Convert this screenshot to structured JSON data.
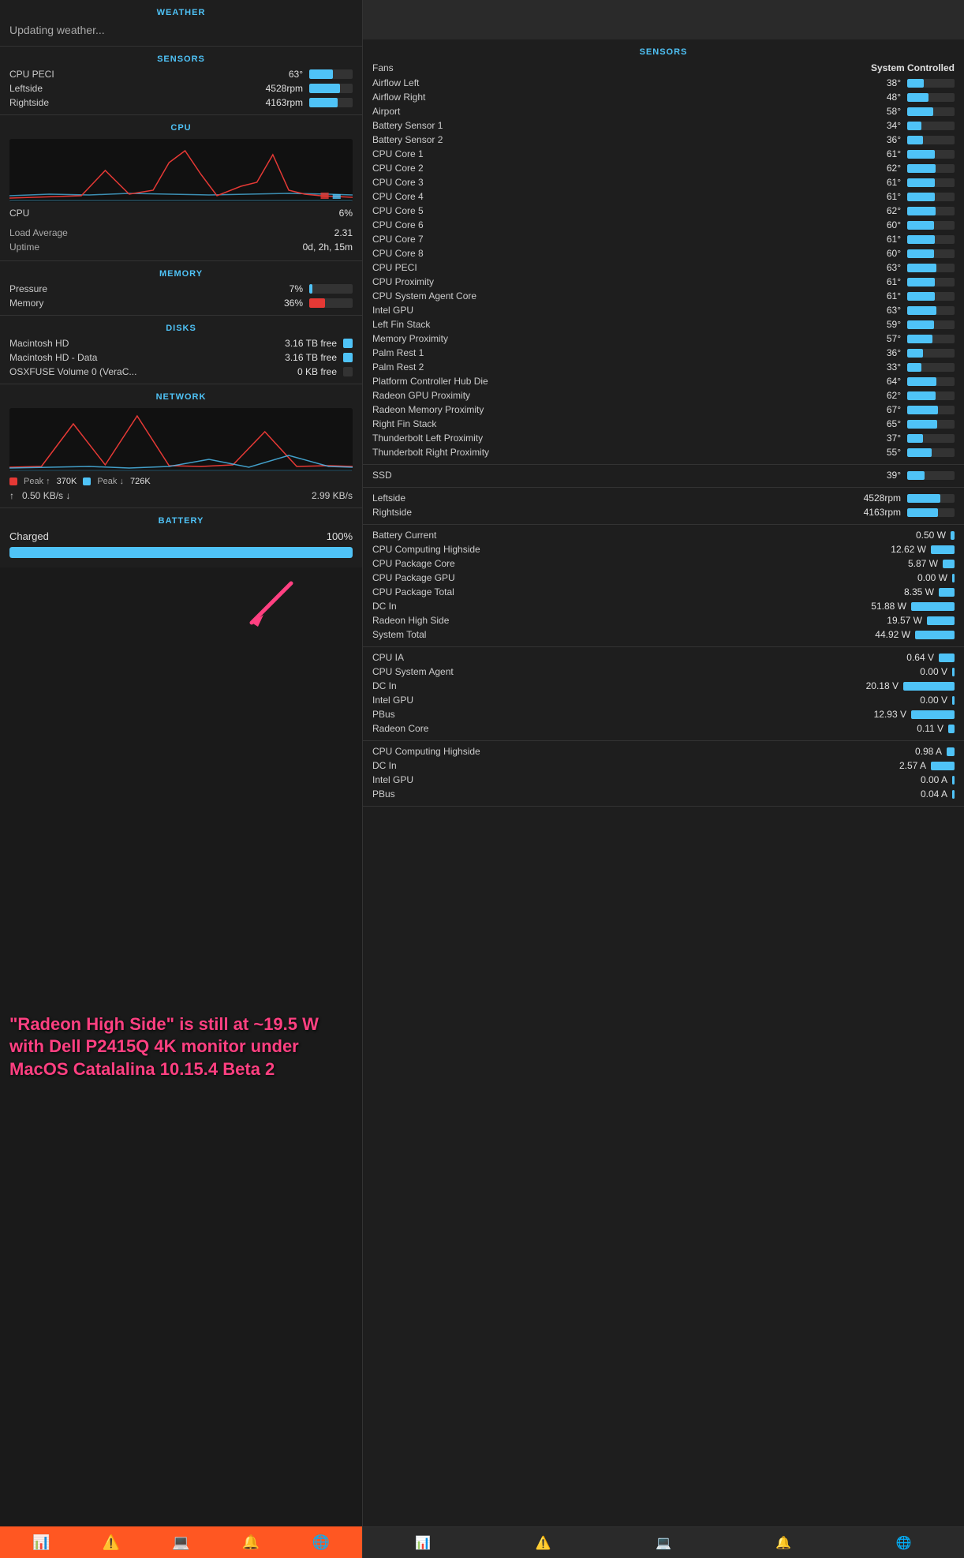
{
  "left": {
    "weather": {
      "header": "WEATHER",
      "status": "Updating weather..."
    },
    "sensors_left": {
      "header": "SENSORS",
      "items": [
        {
          "label": "CPU PECI",
          "value": "63°",
          "bar": 55
        },
        {
          "label": "Leftside",
          "value": "4528rpm",
          "bar": 70
        },
        {
          "label": "Rightside",
          "value": "4163rpm",
          "bar": 65
        }
      ]
    },
    "cpu": {
      "header": "CPU",
      "usage_label": "CPU",
      "usage_value": "6%",
      "load_label": "Load Average",
      "load_value": "2.31",
      "uptime_label": "Uptime",
      "uptime_value": "0d, 2h, 15m"
    },
    "memory": {
      "header": "MEMORY",
      "items": [
        {
          "label": "Pressure",
          "value": "7%",
          "bar": 7,
          "color": "blue"
        },
        {
          "label": "Memory",
          "value": "36%",
          "bar": 36,
          "color": "red"
        }
      ]
    },
    "disks": {
      "header": "DISKS",
      "items": [
        {
          "label": "Macintosh HD",
          "value": "3.16 TB free",
          "has_bar": true
        },
        {
          "label": "Macintosh HD - Data",
          "value": "3.16 TB free",
          "has_bar": true
        },
        {
          "label": "OSXFUSE Volume 0 (VeraC...",
          "value": "0 KB free",
          "has_bar": false
        }
      ]
    },
    "network": {
      "header": "NETWORK",
      "peak_up_label": "Peak ↑",
      "peak_up_value": "370K",
      "peak_down_label": "Peak ↓",
      "peak_down_value": "726K",
      "speed_up": "↑   0.50 KB/s",
      "speed_down": "↓   2.99 KB/s"
    },
    "battery": {
      "header": "BATTERY",
      "label": "Charged",
      "value": "100%",
      "bar": 100
    },
    "bottom_text": "\"Radeon High Side\" is still at ~19.5 W with Dell P2415Q 4K monitor under MacOS Catalalina 10.15.4 Beta 2",
    "dock": {
      "icons": [
        "📊",
        "⚠️",
        "💻",
        "🔔",
        "🌐"
      ]
    }
  },
  "right": {
    "sensors": {
      "header": "SENSORS",
      "fans_label": "Fans",
      "fans_value": "System Controlled",
      "temperature_items": [
        {
          "label": "Airflow Left",
          "value": "38°",
          "bar": 35
        },
        {
          "label": "Airflow Right",
          "value": "48°",
          "bar": 45
        },
        {
          "label": "Airport",
          "value": "58°",
          "bar": 55
        },
        {
          "label": "Battery Sensor 1",
          "value": "34°",
          "bar": 30
        },
        {
          "label": "Battery Sensor 2",
          "value": "36°",
          "bar": 33
        },
        {
          "label": "CPU Core 1",
          "value": "61°",
          "bar": 58
        },
        {
          "label": "CPU Core 2",
          "value": "62°",
          "bar": 60
        },
        {
          "label": "CPU Core 3",
          "value": "61°",
          "bar": 58
        },
        {
          "label": "CPU Core 4",
          "value": "61°",
          "bar": 58
        },
        {
          "label": "CPU Core 5",
          "value": "62°",
          "bar": 60
        },
        {
          "label": "CPU Core 6",
          "value": "60°",
          "bar": 57
        },
        {
          "label": "CPU Core 7",
          "value": "61°",
          "bar": 58
        },
        {
          "label": "CPU Core 8",
          "value": "60°",
          "bar": 57
        },
        {
          "label": "CPU PECI",
          "value": "63°",
          "bar": 61
        },
        {
          "label": "CPU Proximity",
          "value": "61°",
          "bar": 58
        },
        {
          "label": "CPU System Agent Core",
          "value": "61°",
          "bar": 58
        },
        {
          "label": "Intel GPU",
          "value": "63°",
          "bar": 61
        },
        {
          "label": "Left Fin Stack",
          "value": "59°",
          "bar": 56
        },
        {
          "label": "Memory Proximity",
          "value": "57°",
          "bar": 54
        },
        {
          "label": "Palm Rest 1",
          "value": "36°",
          "bar": 33
        },
        {
          "label": "Palm Rest 2",
          "value": "33°",
          "bar": 30
        },
        {
          "label": "Platform Controller Hub Die",
          "value": "64°",
          "bar": 62
        },
        {
          "label": "Radeon GPU Proximity",
          "value": "62°",
          "bar": 60
        },
        {
          "label": "Radeon Memory Proximity",
          "value": "67°",
          "bar": 65
        },
        {
          "label": "Right Fin Stack",
          "value": "65°",
          "bar": 63
        },
        {
          "label": "Thunderbolt Left Proximity",
          "value": "37°",
          "bar": 34
        },
        {
          "label": "Thunderbolt Right Proximity",
          "value": "55°",
          "bar": 52
        }
      ],
      "ssd_label": "SSD",
      "ssd_value": "39°",
      "ssd_bar": 36,
      "fans_items": [
        {
          "label": "Leftside",
          "value": "4528rpm",
          "bar": 70
        },
        {
          "label": "Rightside",
          "value": "4163rpm",
          "bar": 65
        }
      ],
      "watts": [
        {
          "label": "Battery Current",
          "value": "0.50 W",
          "bar": 5
        },
        {
          "label": "CPU Computing Highside",
          "value": "12.62 W",
          "bar": 30
        },
        {
          "label": "CPU Package Core",
          "value": "5.87 W",
          "bar": 15
        },
        {
          "label": "CPU Package GPU",
          "value": "0.00 W",
          "bar": 0
        },
        {
          "label": "CPU Package Total",
          "value": "8.35 W",
          "bar": 20
        },
        {
          "label": "DC In",
          "value": "51.88 W",
          "bar": 55
        },
        {
          "label": "Radeon High Side",
          "value": "19.57 W",
          "bar": 35
        },
        {
          "label": "System Total",
          "value": "44.92 W",
          "bar": 50
        }
      ],
      "volts": [
        {
          "label": "CPU IA",
          "value": "0.64 V",
          "bar": 20
        },
        {
          "label": "CPU System Agent",
          "value": "0.00 V",
          "bar": 0
        },
        {
          "label": "DC In",
          "value": "20.18 V",
          "bar": 65
        },
        {
          "label": "Intel GPU",
          "value": "0.00 V",
          "bar": 0
        },
        {
          "label": "PBus",
          "value": "12.93 V",
          "bar": 55
        },
        {
          "label": "Radeon Core",
          "value": "0.11 V",
          "bar": 8
        }
      ],
      "amps": [
        {
          "label": "CPU Computing Highside",
          "value": "0.98 A",
          "bar": 10
        },
        {
          "label": "DC In",
          "value": "2.57 A",
          "bar": 30
        },
        {
          "label": "Intel GPU",
          "value": "0.00 A",
          "bar": 0
        },
        {
          "label": "PBus",
          "value": "0.04 A",
          "bar": 3
        }
      ]
    },
    "dock": {
      "icons": [
        "📊",
        "⚠️",
        "💻",
        "🔔",
        "🌐"
      ]
    }
  }
}
